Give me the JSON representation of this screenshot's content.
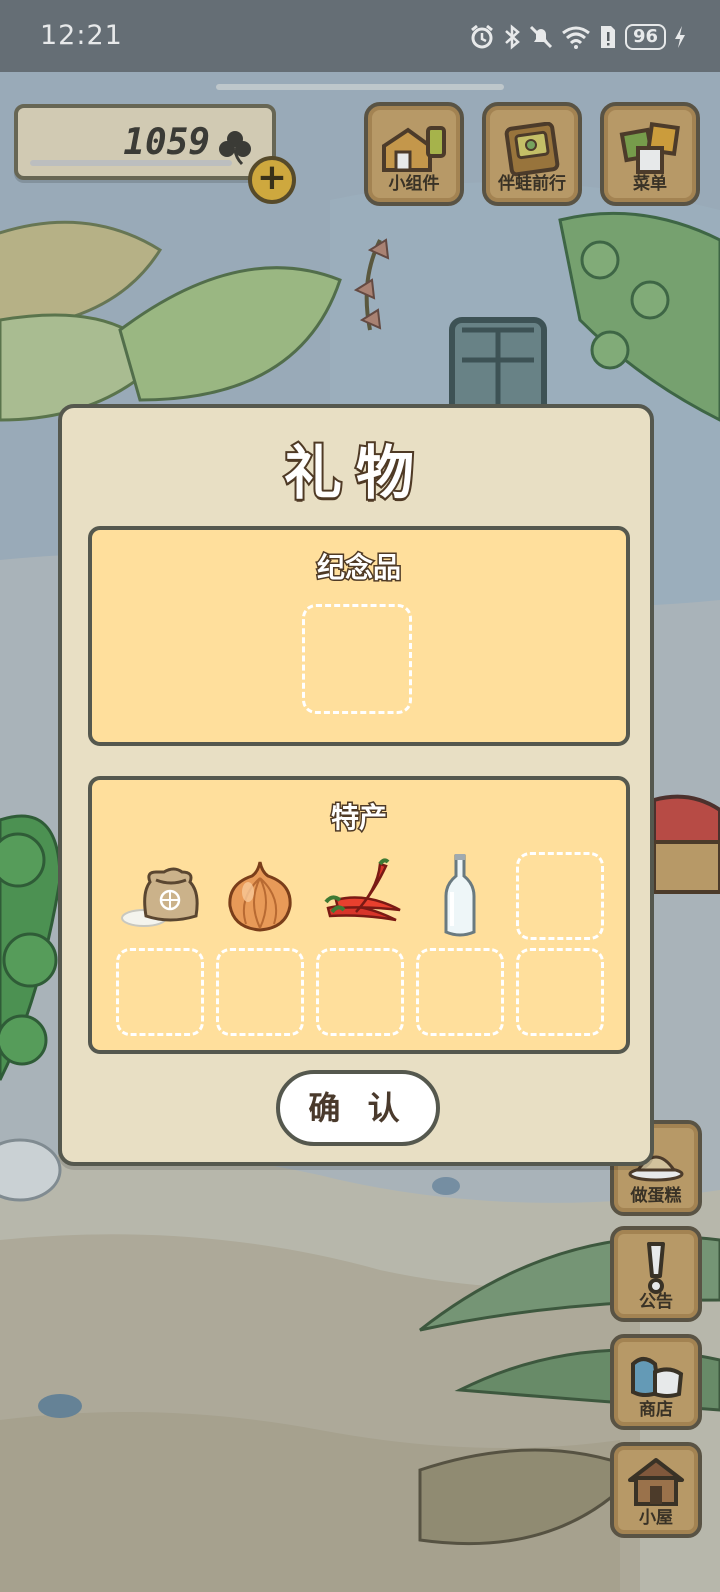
{
  "status_bar": {
    "time": "12:21",
    "battery": "96",
    "icons": [
      "alarm-icon",
      "bluetooth-icon",
      "mute-icon",
      "wifi-icon",
      "sim-icon",
      "battery-icon",
      "charging-icon"
    ]
  },
  "hud": {
    "clover_count": "1059",
    "clover_icon": "clover-icon",
    "add_button": "+",
    "buttons": [
      {
        "label": "小组件",
        "icon": "widget-icon"
      },
      {
        "label": "伴蛙前行",
        "icon": "album-icon"
      },
      {
        "label": "菜单",
        "icon": "menu-icon"
      }
    ]
  },
  "side_buttons": [
    {
      "label": "做蛋糕",
      "icon": "cake-icon"
    },
    {
      "label": "公告",
      "icon": "exclamation-icon"
    },
    {
      "label": "商店",
      "icon": "shop-bag-icon"
    },
    {
      "label": "小屋",
      "icon": "house-icon"
    }
  ],
  "dialog": {
    "title": "礼物",
    "souvenir": {
      "title": "纪念品",
      "slots": 1
    },
    "specialty": {
      "title": "特产",
      "items": [
        "rice-bag-icon",
        "onion-icon",
        "chili-peppers-icon",
        "bottle-icon"
      ],
      "empty_slots": 6
    },
    "confirm_label": "确 认"
  },
  "colors": {
    "panel": "#e8dfc4",
    "section": "#ffdf9c",
    "border": "#55584e",
    "wood": "#c9a46a"
  }
}
